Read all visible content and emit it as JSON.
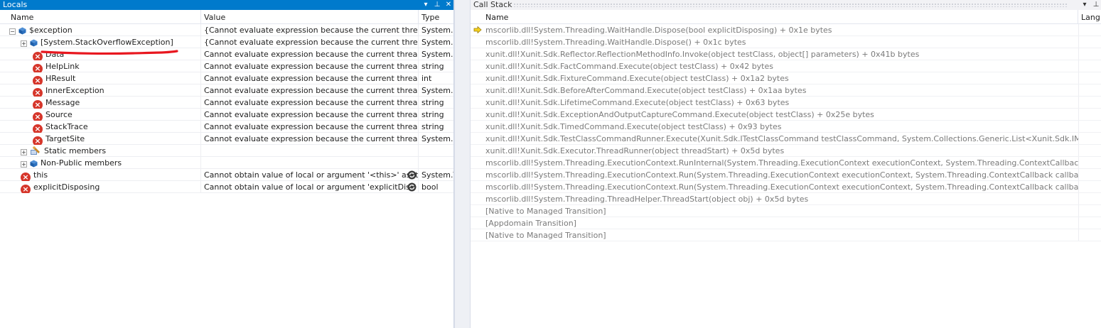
{
  "locals": {
    "title": "Locals",
    "buttons": {
      "dropdown": "▾",
      "pin": "⊥",
      "close": "✕"
    },
    "columns": {
      "name": "Name",
      "value": "Value",
      "type": "Type"
    },
    "rows": [
      {
        "name": "$exception",
        "value": "{Cannot evaluate expression because the current thread is",
        "type": "System.E"
      },
      {
        "name": "[System.StackOverflowException]",
        "value": "{Cannot evaluate expression because the current thread is",
        "type": "System.S"
      },
      {
        "name": "Data",
        "value": "Cannot evaluate expression because the current thread is",
        "type": "System.C"
      },
      {
        "name": "HelpLink",
        "value": "Cannot evaluate expression because the current thread is",
        "type": "string"
      },
      {
        "name": "HResult",
        "value": "Cannot evaluate expression because the current thread is",
        "type": "int"
      },
      {
        "name": "InnerException",
        "value": "Cannot evaluate expression because the current thread is",
        "type": "System.E"
      },
      {
        "name": "Message",
        "value": "Cannot evaluate expression because the current thread is",
        "type": "string"
      },
      {
        "name": "Source",
        "value": "Cannot evaluate expression because the current thread is",
        "type": "string"
      },
      {
        "name": "StackTrace",
        "value": "Cannot evaluate expression because the current thread is",
        "type": "string"
      },
      {
        "name": "TargetSite",
        "value": "Cannot evaluate expression because the current thread is",
        "type": "System.F"
      },
      {
        "name": "Static members",
        "value": "",
        "type": ""
      },
      {
        "name": "Non-Public members",
        "value": "",
        "type": ""
      },
      {
        "name": "this",
        "value": "Cannot obtain value of local or argument '<this>' as it",
        "type": "System.T"
      },
      {
        "name": "explicitDisposing",
        "value": "Cannot obtain value of local or argument 'explicitDisp",
        "type": "bool"
      }
    ]
  },
  "callstack": {
    "title": "Call Stack",
    "buttons": {
      "dropdown": "▾",
      "pin": "⊥"
    },
    "columns": {
      "name": "Name",
      "language": "Lang"
    },
    "frames": [
      "mscorlib.dll!System.Threading.WaitHandle.Dispose(bool explicitDisposing) + 0x1e bytes",
      "mscorlib.dll!System.Threading.WaitHandle.Dispose() + 0x1c bytes",
      "xunit.dll!Xunit.Sdk.Reflector.ReflectionMethodInfo.Invoke(object testClass, object[] parameters) + 0x41b bytes",
      "xunit.dll!Xunit.Sdk.FactCommand.Execute(object testClass) + 0x42 bytes",
      "xunit.dll!Xunit.Sdk.FixtureCommand.Execute(object testClass) + 0x1a2 bytes",
      "xunit.dll!Xunit.Sdk.BeforeAfterCommand.Execute(object testClass) + 0x1aa bytes",
      "xunit.dll!Xunit.Sdk.LifetimeCommand.Execute(object testClass) + 0x63 bytes",
      "xunit.dll!Xunit.Sdk.ExceptionAndOutputCaptureCommand.Execute(object testClass) + 0x25e bytes",
      "xunit.dll!Xunit.Sdk.TimedCommand.Execute(object testClass) + 0x93 bytes",
      "xunit.dll!Xunit.Sdk.TestClassCommandRunner.Execute(Xunit.Sdk.ITestClassCommand testClassCommand, System.Collections.Generic.List<Xunit.Sdk.IMethod",
      "xunit.dll!Xunit.Sdk.Executor.ThreadRunner(object threadStart) + 0x5d bytes",
      "mscorlib.dll!System.Threading.ExecutionContext.RunInternal(System.Threading.ExecutionContext executionContext, System.Threading.ContextCallback callbac",
      "mscorlib.dll!System.Threading.ExecutionContext.Run(System.Threading.ExecutionContext executionContext, System.Threading.ContextCallback callback, obje",
      "mscorlib.dll!System.Threading.ExecutionContext.Run(System.Threading.ExecutionContext executionContext, System.Threading.ContextCallback callback, obje",
      "mscorlib.dll!System.Threading.ThreadHelper.ThreadStart(object obj) + 0x5d bytes",
      "[Native to Managed Transition]",
      "[Appdomain Transition]",
      "[Native to Managed Transition]"
    ]
  },
  "colors": {
    "accent": "#007acc",
    "error": "#d6362b",
    "annotation": "#e8171f"
  }
}
